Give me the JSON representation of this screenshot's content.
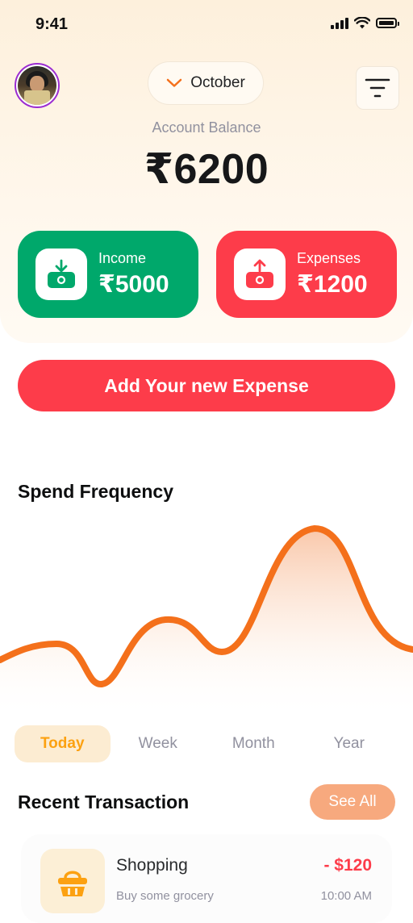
{
  "status_bar": {
    "time": "9:41",
    "signal_icon": "signal-bars-icon",
    "wifi_icon": "wifi-icon",
    "battery_icon": "battery-icon"
  },
  "header": {
    "avatar_icon": "user-avatar",
    "month": "October",
    "month_icon": "chevron-down-icon",
    "menu_icon": "filter-menu-icon"
  },
  "balance": {
    "label": "Account Balance",
    "value": "₹6200"
  },
  "cards": {
    "income": {
      "label": "Income",
      "amount": "₹5000",
      "icon": "income-wallet-icon",
      "color": "#00A86B"
    },
    "expense": {
      "label": "Expenses",
      "amount": "₹1200",
      "icon": "expense-wallet-icon",
      "color": "#FD3C4A"
    }
  },
  "actions": {
    "add_expense": "Add Your new Expense"
  },
  "spend": {
    "title": "Spend Frequency",
    "line_color": "#F4701B",
    "tabs": [
      {
        "label": "Today",
        "active": true
      },
      {
        "label": "Week",
        "active": false
      },
      {
        "label": "Month",
        "active": false
      },
      {
        "label": "Year",
        "active": false
      }
    ]
  },
  "recent": {
    "title": "Recent Transaction",
    "see_all": "See All",
    "transactions": [
      {
        "name": "Shopping",
        "amount": "- $120",
        "description": "Buy some grocery",
        "time": "10:00 AM",
        "icon": "shopping-basket-icon"
      }
    ]
  }
}
